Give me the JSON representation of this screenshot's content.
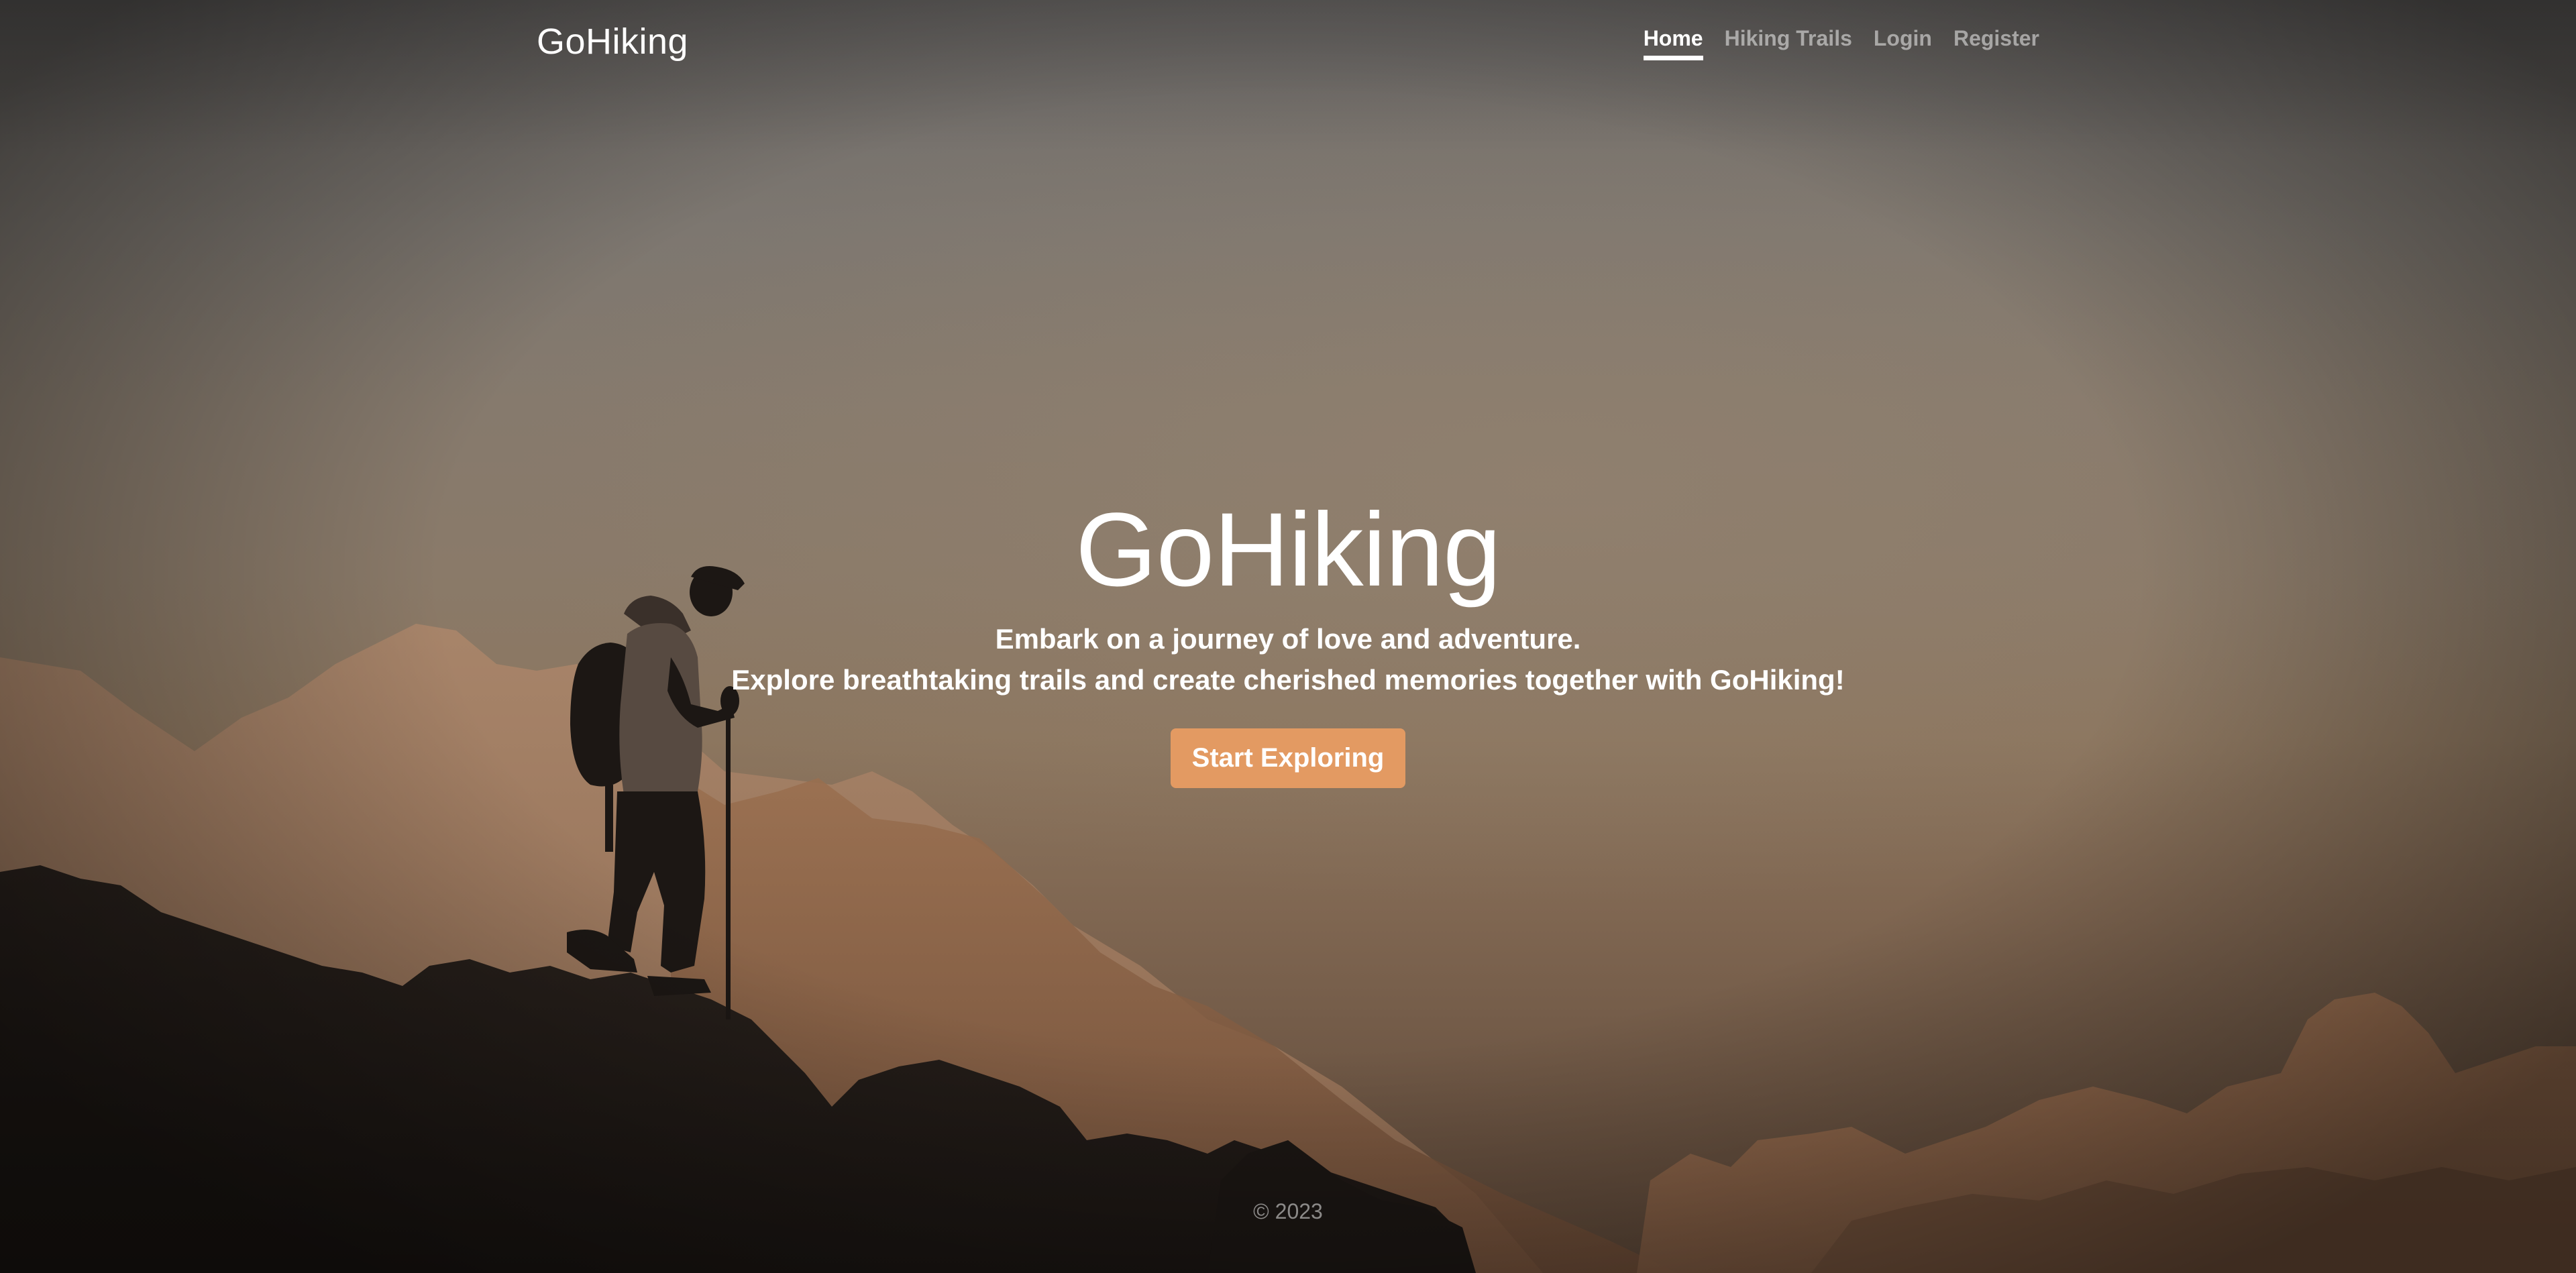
{
  "navbar": {
    "brand": "GoHiking",
    "links": [
      {
        "label": "Home",
        "active": true
      },
      {
        "label": "Hiking Trails",
        "active": false
      },
      {
        "label": "Login",
        "active": false
      },
      {
        "label": "Register",
        "active": false
      }
    ]
  },
  "hero": {
    "title": "GoHiking",
    "lead_line1": "Embark on a journey of love and adventure.",
    "lead_line2": "Explore breathtaking trails and create cherished memories together with GoHiking!",
    "cta_label": "Start Exploring"
  },
  "footer": {
    "text": "© 2023"
  },
  "colors": {
    "accent": "#e39a62",
    "nav_active": "#ffffff",
    "nav_inactive": "rgba(255,255,255,0.5)"
  },
  "background": {
    "subject": "hiker-silhouette-icon",
    "scene": "mountain-range-at-sunset"
  }
}
